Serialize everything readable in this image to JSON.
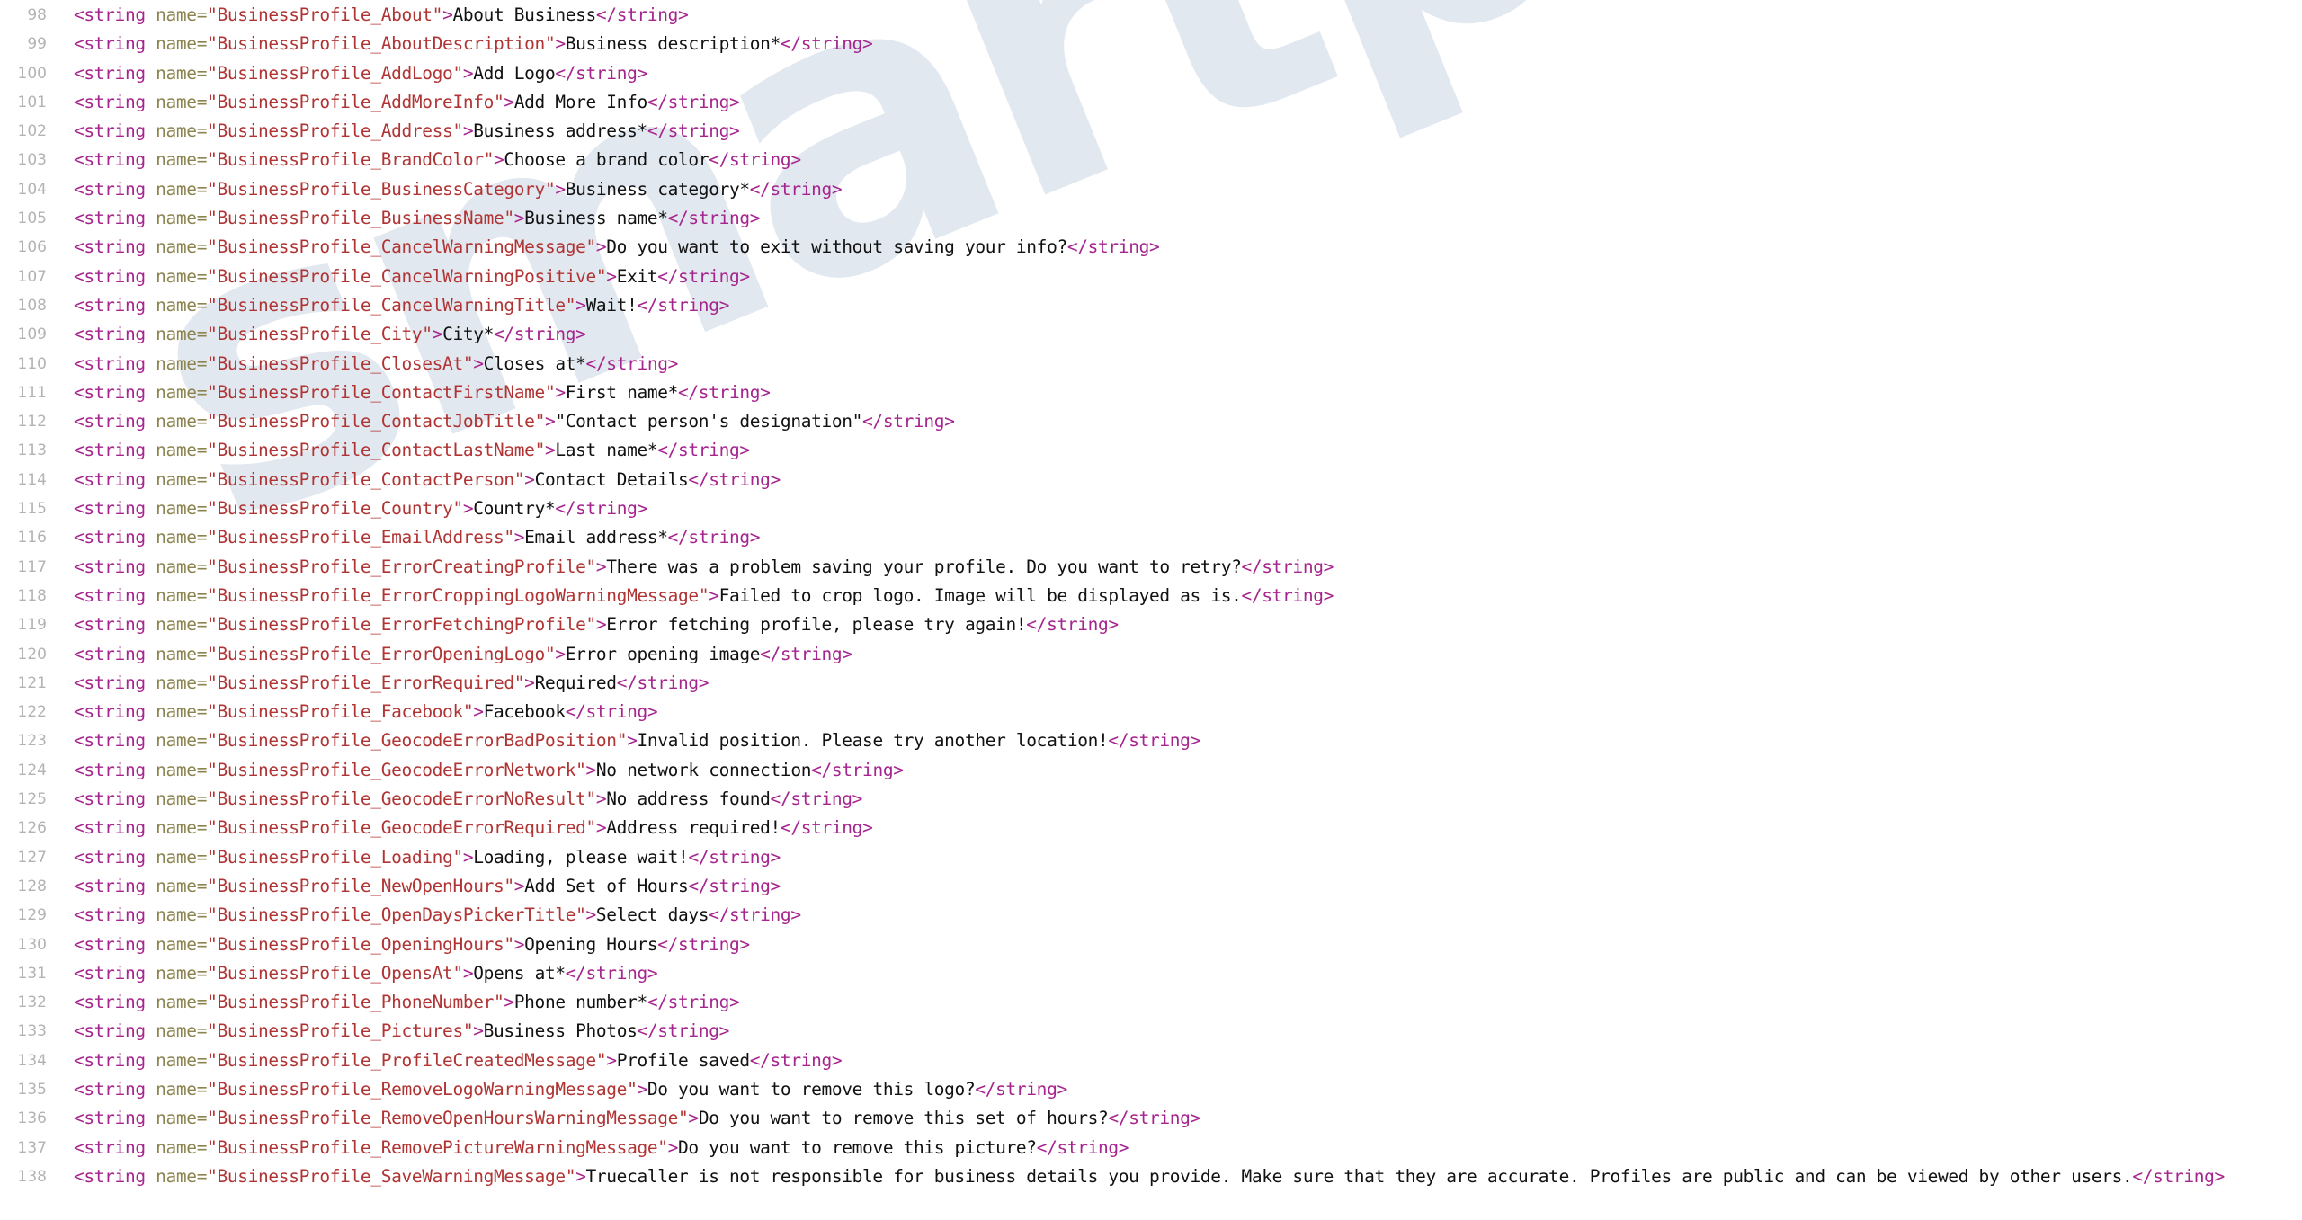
{
  "watermark": {
    "text": "smartprice"
  },
  "colors": {
    "background": "#ffffff",
    "gutter_text": "#b3b3b3",
    "tag": "#a6248e",
    "attribute_name": "#8c8450",
    "attribute_value": "#b03434",
    "element_text": "#111111",
    "watermark": "#e2e8ef"
  },
  "editor": {
    "language": "xml",
    "first_line_number": 98,
    "last_line_number": 138,
    "tag_open": "<string",
    "tag_close_open": "</string>",
    "attr_name": "name",
    "equals": "=",
    "quote": "\"",
    "gt": ">"
  },
  "lines": [
    {
      "num": "98",
      "key": "BusinessProfile_About",
      "value": "About Business"
    },
    {
      "num": "99",
      "key": "BusinessProfile_AboutDescription",
      "value": "Business description*"
    },
    {
      "num": "100",
      "key": "BusinessProfile_AddLogo",
      "value": "Add Logo"
    },
    {
      "num": "101",
      "key": "BusinessProfile_AddMoreInfo",
      "value": "Add More Info"
    },
    {
      "num": "102",
      "key": "BusinessProfile_Address",
      "value": "Business address*"
    },
    {
      "num": "103",
      "key": "BusinessProfile_BrandColor",
      "value": "Choose a brand color"
    },
    {
      "num": "104",
      "key": "BusinessProfile_BusinessCategory",
      "value": "Business category*"
    },
    {
      "num": "105",
      "key": "BusinessProfile_BusinessName",
      "value": "Business name*"
    },
    {
      "num": "106",
      "key": "BusinessProfile_CancelWarningMessage",
      "value": "Do you want to exit without saving your info?"
    },
    {
      "num": "107",
      "key": "BusinessProfile_CancelWarningPositive",
      "value": "Exit"
    },
    {
      "num": "108",
      "key": "BusinessProfile_CancelWarningTitle",
      "value": "Wait!"
    },
    {
      "num": "109",
      "key": "BusinessProfile_City",
      "value": "City*"
    },
    {
      "num": "110",
      "key": "BusinessProfile_ClosesAt",
      "value": "Closes at*"
    },
    {
      "num": "111",
      "key": "BusinessProfile_ContactFirstName",
      "value": "First name*"
    },
    {
      "num": "112",
      "key": "BusinessProfile_ContactJobTitle",
      "value": "\"Contact person's designation\""
    },
    {
      "num": "113",
      "key": "BusinessProfile_ContactLastName",
      "value": "Last name*"
    },
    {
      "num": "114",
      "key": "BusinessProfile_ContactPerson",
      "value": "Contact Details"
    },
    {
      "num": "115",
      "key": "BusinessProfile_Country",
      "value": "Country*"
    },
    {
      "num": "116",
      "key": "BusinessProfile_EmailAddress",
      "value": "Email address*"
    },
    {
      "num": "117",
      "key": "BusinessProfile_ErrorCreatingProfile",
      "value": "There was a problem saving your profile. Do you want to retry?"
    },
    {
      "num": "118",
      "key": "BusinessProfile_ErrorCroppingLogoWarningMessage",
      "value": "Failed to crop logo. Image will be displayed as is."
    },
    {
      "num": "119",
      "key": "BusinessProfile_ErrorFetchingProfile",
      "value": "Error fetching profile, please try again!"
    },
    {
      "num": "120",
      "key": "BusinessProfile_ErrorOpeningLogo",
      "value": "Error opening image"
    },
    {
      "num": "121",
      "key": "BusinessProfile_ErrorRequired",
      "value": "Required"
    },
    {
      "num": "122",
      "key": "BusinessProfile_Facebook",
      "value": "Facebook"
    },
    {
      "num": "123",
      "key": "BusinessProfile_GeocodeErrorBadPosition",
      "value": "Invalid position. Please try another location!"
    },
    {
      "num": "124",
      "key": "BusinessProfile_GeocodeErrorNetwork",
      "value": "No network connection"
    },
    {
      "num": "125",
      "key": "BusinessProfile_GeocodeErrorNoResult",
      "value": "No address found"
    },
    {
      "num": "126",
      "key": "BusinessProfile_GeocodeErrorRequired",
      "value": "Address required!"
    },
    {
      "num": "127",
      "key": "BusinessProfile_Loading",
      "value": "Loading, please wait!"
    },
    {
      "num": "128",
      "key": "BusinessProfile_NewOpenHours",
      "value": "Add Set of Hours"
    },
    {
      "num": "129",
      "key": "BusinessProfile_OpenDaysPickerTitle",
      "value": "Select days"
    },
    {
      "num": "130",
      "key": "BusinessProfile_OpeningHours",
      "value": "Opening Hours"
    },
    {
      "num": "131",
      "key": "BusinessProfile_OpensAt",
      "value": "Opens at*"
    },
    {
      "num": "132",
      "key": "BusinessProfile_PhoneNumber",
      "value": "Phone number*"
    },
    {
      "num": "133",
      "key": "BusinessProfile_Pictures",
      "value": "Business Photos"
    },
    {
      "num": "134",
      "key": "BusinessProfile_ProfileCreatedMessage",
      "value": "Profile saved"
    },
    {
      "num": "135",
      "key": "BusinessProfile_RemoveLogoWarningMessage",
      "value": "Do you want to remove this logo?"
    },
    {
      "num": "136",
      "key": "BusinessProfile_RemoveOpenHoursWarningMessage",
      "value": "Do you want to remove this set of hours?"
    },
    {
      "num": "137",
      "key": "BusinessProfile_RemovePictureWarningMessage",
      "value": "Do you want to remove this picture?"
    },
    {
      "num": "138",
      "key": "BusinessProfile_SaveWarningMessage",
      "value": "Truecaller is not responsible for business details you provide. Make sure that they are accurate. Profiles are public and can be viewed by other users.",
      "wrapped": true
    }
  ]
}
